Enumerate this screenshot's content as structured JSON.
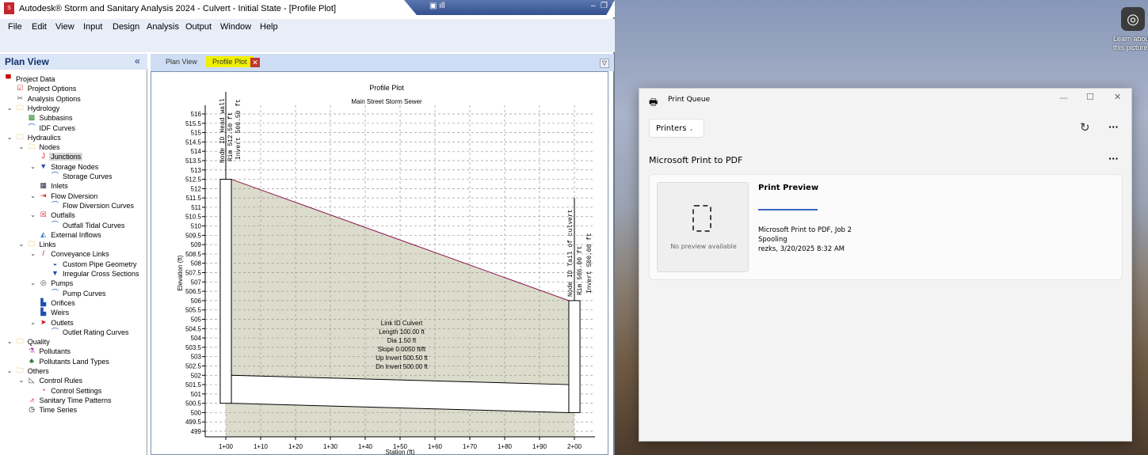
{
  "desktop": {
    "learn_text": "Learn about this picture"
  },
  "app": {
    "title": "Autodesk® Storm and Sanitary Analysis 2024 - Culvert - Initial State - [Profile Plot]",
    "menu": [
      "File",
      "Edit",
      "View",
      "Input",
      "Design",
      "Analysis",
      "Output",
      "Window",
      "Help"
    ],
    "toolbar_icons": [
      "new-icon",
      "open-icon",
      "save-icon",
      "print-icon",
      "grid-icon",
      "pan-icon",
      "copy-icon",
      "delete-icon",
      "find-icon",
      "filter-icon",
      "run-icon",
      "help-icon",
      "subbasin-icon",
      "export-icon",
      "junction-icon",
      "outfall-icon",
      "flow-diversion-icon",
      "inlet-icon",
      "storage-icon",
      "pipe-icon",
      "pump-icon",
      "orifice-icon",
      "weir-icon",
      "outlet-icon",
      "select-icon",
      "edit-vertex-icon",
      "polygon-icon",
      "text-icon",
      "pencil-icon",
      "play-icon",
      "report-icon",
      "excel-icon",
      "pdf-icon",
      "image-icon"
    ],
    "plan_view_title": "Plan View",
    "tabs": [
      {
        "label": "Plan View"
      },
      {
        "label": "Profile Plot",
        "active": true
      }
    ],
    "tree": [
      {
        "d": 0,
        "label": "Project Data",
        "icon": "project-icon"
      },
      {
        "d": 1,
        "label": "Project Options",
        "icon": "checklist-icon"
      },
      {
        "d": 1,
        "label": "Analysis Options",
        "icon": "tools-icon"
      },
      {
        "d": 1,
        "label": "Hydrology",
        "icon": "folder-icon",
        "exp": true
      },
      {
        "d": 2,
        "label": "Subbasins",
        "icon": "subbasin-icon"
      },
      {
        "d": 2,
        "label": "IDF Curves",
        "icon": "curve-icon"
      },
      {
        "d": 1,
        "label": "Hydraulics",
        "icon": "folder-icon",
        "exp": true
      },
      {
        "d": 2,
        "label": "Nodes",
        "icon": "folder-icon",
        "exp": true
      },
      {
        "d": 3,
        "label": "Junctions",
        "icon": "junction-icon",
        "sel": true
      },
      {
        "d": 3,
        "label": "Storage Nodes",
        "icon": "storage-icon",
        "exp": true
      },
      {
        "d": 4,
        "label": "Storage Curves",
        "icon": "curve-icon"
      },
      {
        "d": 3,
        "label": "Inlets",
        "icon": "inlet-icon"
      },
      {
        "d": 3,
        "label": "Flow Diversion",
        "icon": "diversion-icon",
        "exp": true
      },
      {
        "d": 4,
        "label": "Flow Diversion Curves",
        "icon": "curve-icon"
      },
      {
        "d": 3,
        "label": "Outfalls",
        "icon": "outfall-icon",
        "exp": true
      },
      {
        "d": 4,
        "label": "Outfall Tidal Curves",
        "icon": "curve-icon"
      },
      {
        "d": 3,
        "label": "External Inflows",
        "icon": "inflow-icon"
      },
      {
        "d": 2,
        "label": "Links",
        "icon": "folder-icon",
        "exp": true
      },
      {
        "d": 3,
        "label": "Conveyance Links",
        "icon": "pipe-icon",
        "exp": true
      },
      {
        "d": 4,
        "label": "Custom Pipe Geometry",
        "icon": "pipe-geometry-icon"
      },
      {
        "d": 4,
        "label": "Irregular Cross Sections",
        "icon": "cross-section-icon"
      },
      {
        "d": 3,
        "label": "Pumps",
        "icon": "pump-icon",
        "exp": true
      },
      {
        "d": 4,
        "label": "Pump Curves",
        "icon": "curve-icon"
      },
      {
        "d": 3,
        "label": "Orifices",
        "icon": "orifice-icon"
      },
      {
        "d": 3,
        "label": "Weirs",
        "icon": "weir-icon"
      },
      {
        "d": 3,
        "label": "Outlets",
        "icon": "outlet-icon",
        "exp": true
      },
      {
        "d": 4,
        "label": "Outlet Rating Curves",
        "icon": "curve-icon"
      },
      {
        "d": 1,
        "label": "Quality",
        "icon": "folder-icon",
        "exp": true
      },
      {
        "d": 2,
        "label": "Pollutants",
        "icon": "flask-icon"
      },
      {
        "d": 2,
        "label": "Pollutants Land Types",
        "icon": "tree-icon"
      },
      {
        "d": 1,
        "label": "Others",
        "icon": "folder-icon",
        "exp": true
      },
      {
        "d": 2,
        "label": "Control Rules",
        "icon": "rules-icon",
        "exp": true
      },
      {
        "d": 3,
        "label": "Control Settings",
        "icon": "gauge-icon"
      },
      {
        "d": 2,
        "label": "Sanitary Time Patterns",
        "icon": "pattern-icon"
      },
      {
        "d": 2,
        "label": "Time Series",
        "icon": "clock-icon"
      }
    ]
  },
  "chart_data": {
    "type": "profile",
    "title": "Profile Plot",
    "subtitle": "Main Street Storm Sewer",
    "xlabel": "Station (ft)",
    "ylabel": "Elevation (ft)",
    "ylim": [
      499,
      516
    ],
    "xlim": [
      100,
      200
    ],
    "yticks": [
      "516",
      "515.5",
      "515",
      "514.5",
      "514",
      "513.5",
      "513",
      "512.5",
      "512",
      "511.5",
      "511",
      "510.5",
      "510",
      "509.5",
      "509",
      "508.5",
      "508",
      "507.5",
      "507",
      "506.5",
      "506",
      "505.5",
      "505",
      "504.5",
      "504",
      "503.5",
      "503",
      "502.5",
      "502",
      "501.5",
      "501",
      "500.5",
      "500",
      "499.5",
      "499"
    ],
    "xticks": [
      "1+00",
      "1+10",
      "1+20",
      "1+30",
      "1+40",
      "1+50",
      "1+60",
      "1+70",
      "1+80",
      "1+90",
      "2+00"
    ],
    "up_node": {
      "station": 100,
      "rim": 512.5,
      "invert": 500.5,
      "labels": [
        "Node ID Head wall",
        "Rim 512.50 ft",
        "Invert 500.50 ft"
      ]
    },
    "dn_node": {
      "station": 200,
      "rim": 506.0,
      "invert": 500.0,
      "labels": [
        "Node ID Tail of culvert",
        "Rim 506.00 ft",
        "Invert 500.00 ft"
      ]
    },
    "link": {
      "diameter": 1.5,
      "up_invert": 500.5,
      "dn_invert": 500.0,
      "labels": [
        "Link ID Culvert",
        "Length 100.00 ft",
        "Dia 1.50 ft",
        "Slope 0.0050 ft/ft",
        "Up Invert 500.50 ft",
        "Dn Invert 500.00 ft"
      ]
    },
    "colors": {
      "ground": "#dcdccc",
      "ground_line": "#8b1a4a"
    }
  },
  "print_queue": {
    "title": "Print Queue",
    "printers_label": "Printers",
    "printer_name": "Microsoft Print to PDF",
    "preview_title": "Print Preview",
    "no_preview": "No preview available",
    "job": "Microsoft Print to PDF, Job 2",
    "status": "Spooling",
    "owner_time": "rezks, 3/20/2025 8:32 AM",
    "progress": 0.2
  }
}
